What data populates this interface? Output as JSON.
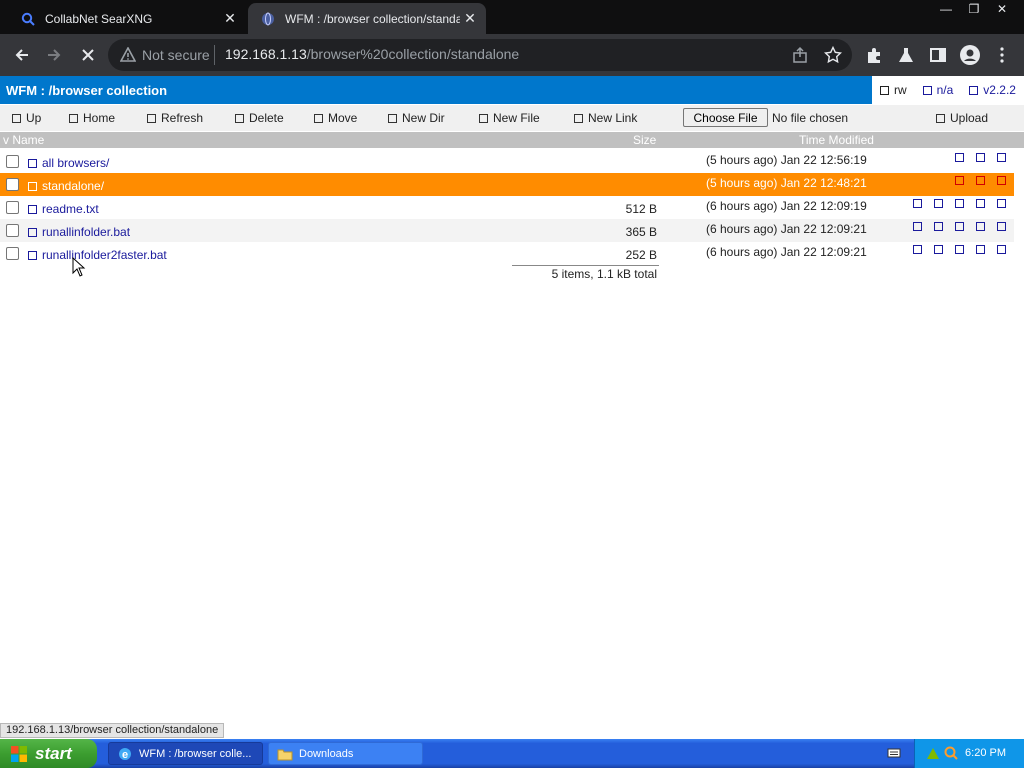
{
  "browser": {
    "tabs": [
      {
        "title": "CollabNet SearXNG",
        "icon": "searxng-icon"
      },
      {
        "title": "WFM : /browser collection/standalo",
        "icon": "wfm-icon"
      }
    ],
    "omnibox": {
      "security": "Not secure",
      "host": "192.168.1.13",
      "path": "/browser%20collection/standalone"
    }
  },
  "wfm": {
    "title": "WFM : /browser collection",
    "meta": {
      "rw": "rw",
      "na": "n/a",
      "version": "v2.2.2"
    },
    "actions": {
      "up": "Up",
      "home": "Home",
      "refresh": "Refresh",
      "delete": "Delete",
      "move": "Move",
      "new_dir": "New Dir",
      "new_file": "New File",
      "new_link": "New Link",
      "choose_file": "Choose File",
      "no_file": "No file chosen",
      "upload": "Upload"
    },
    "columns": {
      "name": "v Name",
      "size": "Size",
      "modified": "Time Modified"
    },
    "files": [
      {
        "name": "all browsers/",
        "size": "",
        "modified": "(5 hours ago) Jan 22 12:56:19"
      },
      {
        "name": "standalone/",
        "size": "",
        "modified": "(5 hours ago) Jan 22 12:48:21"
      },
      {
        "name": "readme.txt",
        "size": "512 B",
        "modified": "(6 hours ago) Jan 22 12:09:19"
      },
      {
        "name": "runallinfolder.bat",
        "size": "365 B",
        "modified": "(6 hours ago) Jan 22 12:09:21"
      },
      {
        "name": "runallinfolder2faster.bat",
        "size": "252 B",
        "modified": "(6 hours ago) Jan 22 12:09:21"
      }
    ],
    "summary": "5 items, 1.1 kB total"
  },
  "status_url": "192.168.1.13/browser collection/standalone",
  "taskbar": {
    "start": "start",
    "tasks": [
      {
        "label": "WFM : /browser colle...",
        "icon": "ie-icon"
      },
      {
        "label": "Downloads",
        "icon": "folder-icon"
      }
    ],
    "time": "6:20 PM"
  },
  "colors": {
    "header_blue": "#0077cc",
    "selected_row": "#ff8c00",
    "link": "#1a1a9c"
  }
}
